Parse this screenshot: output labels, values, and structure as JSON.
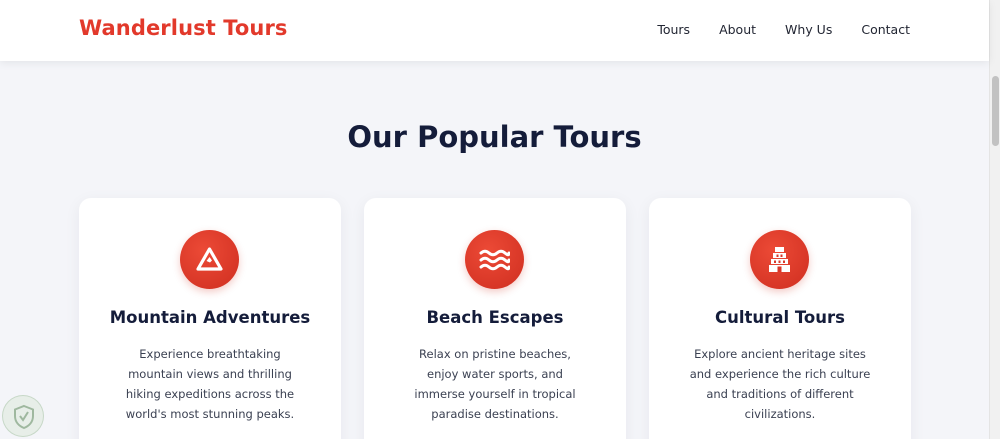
{
  "header": {
    "brand": "Wanderlust Tours",
    "nav": [
      "Tours",
      "About",
      "Why Us",
      "Contact"
    ]
  },
  "main": {
    "title": "Our Popular Tours",
    "cards": [
      {
        "icon": "mountain-icon",
        "title": "Mountain Adventures",
        "description": "Experience breathtaking mountain views and thrilling hiking expeditions across the world's most stunning peaks."
      },
      {
        "icon": "waves-icon",
        "title": "Beach Escapes",
        "description": "Relax on pristine beaches, enjoy water sports, and immerse yourself in tropical paradise destinations."
      },
      {
        "icon": "temple-icon",
        "title": "Cultural Tours",
        "description": "Explore ancient heritage sites and experience the rich culture and traditions of different civilizations."
      }
    ]
  },
  "colors": {
    "accent": "#e2392b",
    "heading": "#141c3a",
    "background": "#f4f5f9"
  }
}
